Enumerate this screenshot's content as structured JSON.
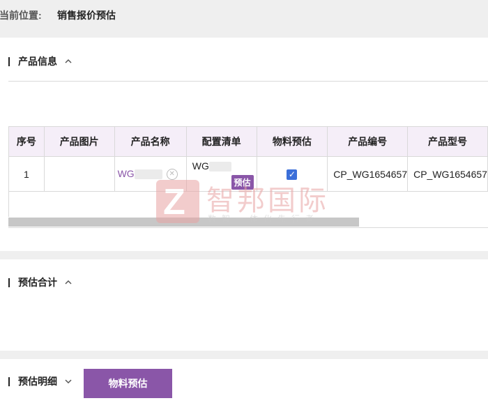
{
  "breadcrumb": {
    "label": "当前位置:",
    "current": "销售报价预估"
  },
  "sections": {
    "product_info": {
      "title": "产品信息"
    },
    "estimate_total": {
      "title": "预估合计"
    },
    "estimate_detail": {
      "title": "预估明细",
      "button_label": "物料预估"
    }
  },
  "table": {
    "headers": [
      "序号",
      "产品图片",
      "产品名称",
      "配置清单",
      "物料预估",
      "产品编号",
      "产品型号"
    ],
    "row": {
      "index": "1",
      "image": "",
      "name_prefix": "WG",
      "config_prefix": "WG",
      "estimate_tag": "预估",
      "material_estimate_checked": true,
      "product_code": "CP_WG1654657",
      "product_model": "CP_WG1654657"
    }
  },
  "watermark": {
    "title": "智邦国际",
    "subtitle": "数智一体化先行者"
  },
  "icons": {
    "collapse": "chevron-up-icon",
    "expand": "chevron-down-icon",
    "clear": "clear-circle-icon",
    "check": "checkbox-checked-icon"
  },
  "colors": {
    "accent": "#8a56a8",
    "header_bg": "#f5eef8",
    "checkbox": "#3b6fd9"
  }
}
